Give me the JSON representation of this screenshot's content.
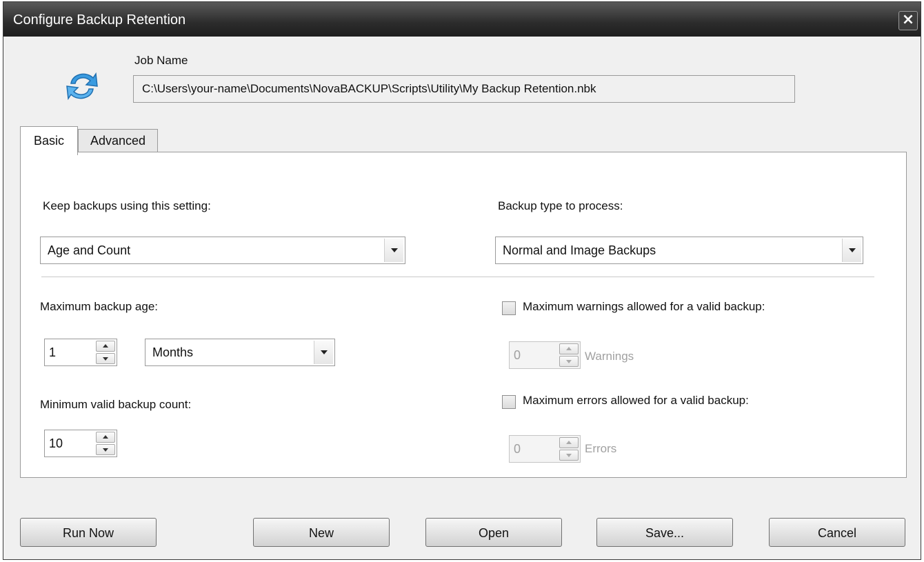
{
  "window": {
    "title": "Configure Backup Retention",
    "close_label": "×"
  },
  "job": {
    "label": "Job Name",
    "path": "C:\\Users\\your-name\\Documents\\NovaBACKUP\\Scripts\\Utility\\My Backup Retention.nbk"
  },
  "tabs": [
    {
      "label": "Basic",
      "active": true
    },
    {
      "label": "Advanced",
      "active": false
    }
  ],
  "basic": {
    "keep_setting": {
      "label": "Keep backups using this setting:",
      "value": "Age and Count"
    },
    "backup_type": {
      "label": "Backup type to process:",
      "value": "Normal and Image Backups"
    },
    "max_age": {
      "label": "Maximum backup age:",
      "value": "1",
      "unit": "Months"
    },
    "min_count": {
      "label": "Minimum valid backup count:",
      "value": "10"
    },
    "max_warnings": {
      "label": "Maximum warnings allowed for a valid backup:",
      "checked": false,
      "value": "0",
      "unit": "Warnings"
    },
    "max_errors": {
      "label": "Maximum errors allowed for a valid backup:",
      "checked": false,
      "value": "0",
      "unit": "Errors"
    }
  },
  "buttons": {
    "run_now": "Run Now",
    "new": "New",
    "open": "Open",
    "save": "Save...",
    "cancel": "Cancel"
  },
  "colors": {
    "titlebar": "#2c2c2c",
    "icon_blue": "#2b8fd8",
    "disabled_text": "#a0a0a0"
  },
  "icons": [
    "refresh-arrows-icon",
    "close-icon",
    "dropdown-arrow-icon",
    "spin-up-icon",
    "spin-down-icon"
  ]
}
